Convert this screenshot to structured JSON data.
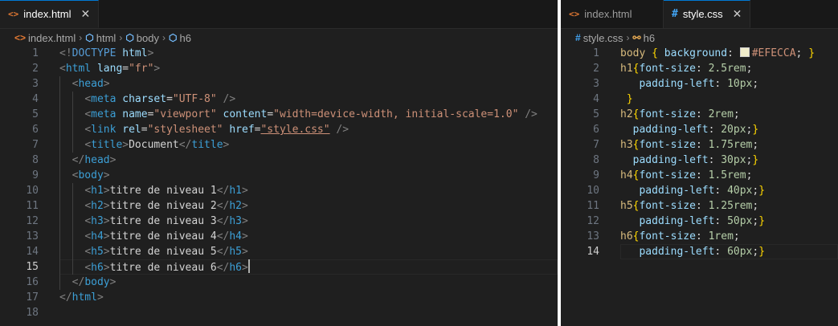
{
  "left": {
    "tab": {
      "icon": "html-file-icon",
      "label": "index.html",
      "close": "✕"
    },
    "breadcrumb": [
      "index.html",
      "html",
      "body",
      "h6"
    ],
    "current_line": 15,
    "lines": [
      [
        [
          "t-punc",
          "<!"
        ],
        [
          "t-decl",
          "DOCTYPE"
        ],
        [
          "t-text",
          " "
        ],
        [
          "t-attr",
          "html"
        ],
        [
          "t-punc",
          ">"
        ]
      ],
      [
        [
          "t-punc",
          "<"
        ],
        [
          "t-tag",
          "html"
        ],
        [
          "t-text",
          " "
        ],
        [
          "t-attr",
          "lang"
        ],
        [
          "t-text",
          "="
        ],
        [
          "t-str",
          "\"fr\""
        ],
        [
          "t-punc",
          ">"
        ]
      ],
      [
        [
          "t-text",
          "  "
        ],
        [
          "t-punc",
          "<"
        ],
        [
          "t-tag",
          "head"
        ],
        [
          "t-punc",
          ">"
        ]
      ],
      [
        [
          "t-text",
          "    "
        ],
        [
          "t-punc",
          "<"
        ],
        [
          "t-tag",
          "meta"
        ],
        [
          "t-text",
          " "
        ],
        [
          "t-attr",
          "charset"
        ],
        [
          "t-text",
          "="
        ],
        [
          "t-str",
          "\"UTF-8\""
        ],
        [
          "t-text",
          " "
        ],
        [
          "t-punc",
          "/>"
        ]
      ],
      [
        [
          "t-text",
          "    "
        ],
        [
          "t-punc",
          "<"
        ],
        [
          "t-tag",
          "meta"
        ],
        [
          "t-text",
          " "
        ],
        [
          "t-attr",
          "name"
        ],
        [
          "t-text",
          "="
        ],
        [
          "t-str",
          "\"viewport\""
        ],
        [
          "t-text",
          " "
        ],
        [
          "t-attr",
          "content"
        ],
        [
          "t-text",
          "="
        ],
        [
          "t-str",
          "\"width=device-width, initial-scale=1.0\""
        ],
        [
          "t-text",
          " "
        ],
        [
          "t-punc",
          "/>"
        ]
      ],
      [
        [
          "t-text",
          "    "
        ],
        [
          "t-punc",
          "<"
        ],
        [
          "t-tag",
          "link"
        ],
        [
          "t-text",
          " "
        ],
        [
          "t-attr",
          "rel"
        ],
        [
          "t-text",
          "="
        ],
        [
          "t-str",
          "\"stylesheet\""
        ],
        [
          "t-text",
          " "
        ],
        [
          "t-attr",
          "href"
        ],
        [
          "t-text",
          "="
        ],
        [
          "t-str u",
          "\"style.css\""
        ],
        [
          "t-text",
          " "
        ],
        [
          "t-punc",
          "/>"
        ]
      ],
      [
        [
          "t-text",
          "    "
        ],
        [
          "t-punc",
          "<"
        ],
        [
          "t-tag",
          "title"
        ],
        [
          "t-punc",
          ">"
        ],
        [
          "t-text",
          "Document"
        ],
        [
          "t-punc",
          "</"
        ],
        [
          "t-tag",
          "title"
        ],
        [
          "t-punc",
          ">"
        ]
      ],
      [
        [
          "t-text",
          "  "
        ],
        [
          "t-punc",
          "</"
        ],
        [
          "t-tag",
          "head"
        ],
        [
          "t-punc",
          ">"
        ]
      ],
      [
        [
          "t-text",
          "  "
        ],
        [
          "t-punc",
          "<"
        ],
        [
          "t-tag",
          "body"
        ],
        [
          "t-punc",
          ">"
        ]
      ],
      [
        [
          "t-text",
          "    "
        ],
        [
          "t-punc",
          "<"
        ],
        [
          "t-tag",
          "h1"
        ],
        [
          "t-punc",
          ">"
        ],
        [
          "t-text",
          "titre de niveau 1"
        ],
        [
          "t-punc",
          "</"
        ],
        [
          "t-tag",
          "h1"
        ],
        [
          "t-punc",
          ">"
        ]
      ],
      [
        [
          "t-text",
          "    "
        ],
        [
          "t-punc",
          "<"
        ],
        [
          "t-tag",
          "h2"
        ],
        [
          "t-punc",
          ">"
        ],
        [
          "t-text",
          "titre de niveau 2"
        ],
        [
          "t-punc",
          "</"
        ],
        [
          "t-tag",
          "h2"
        ],
        [
          "t-punc",
          ">"
        ]
      ],
      [
        [
          "t-text",
          "    "
        ],
        [
          "t-punc",
          "<"
        ],
        [
          "t-tag",
          "h3"
        ],
        [
          "t-punc",
          ">"
        ],
        [
          "t-text",
          "titre de niveau 3"
        ],
        [
          "t-punc",
          "</"
        ],
        [
          "t-tag",
          "h3"
        ],
        [
          "t-punc",
          ">"
        ]
      ],
      [
        [
          "t-text",
          "    "
        ],
        [
          "t-punc",
          "<"
        ],
        [
          "t-tag",
          "h4"
        ],
        [
          "t-punc",
          ">"
        ],
        [
          "t-text",
          "titre de niveau 4"
        ],
        [
          "t-punc",
          "</"
        ],
        [
          "t-tag",
          "h4"
        ],
        [
          "t-punc",
          ">"
        ]
      ],
      [
        [
          "t-text",
          "    "
        ],
        [
          "t-punc",
          "<"
        ],
        [
          "t-tag",
          "h5"
        ],
        [
          "t-punc",
          ">"
        ],
        [
          "t-text",
          "titre de niveau 5"
        ],
        [
          "t-punc",
          "</"
        ],
        [
          "t-tag",
          "h5"
        ],
        [
          "t-punc",
          ">"
        ]
      ],
      [
        [
          "t-text",
          "    "
        ],
        [
          "t-punc",
          "<"
        ],
        [
          "t-tag",
          "h6"
        ],
        [
          "t-punc",
          ">"
        ],
        [
          "t-text",
          "titre de niveau 6"
        ],
        [
          "t-punc",
          "</"
        ],
        [
          "t-tag",
          "h6"
        ],
        [
          "t-punc",
          ">"
        ],
        [
          "caret",
          ""
        ]
      ],
      [
        [
          "t-text",
          "  "
        ],
        [
          "t-punc",
          "</"
        ],
        [
          "t-tag",
          "body"
        ],
        [
          "t-punc",
          ">"
        ]
      ],
      [
        [
          "t-punc",
          "</"
        ],
        [
          "t-tag",
          "html"
        ],
        [
          "t-punc",
          ">"
        ]
      ],
      []
    ]
  },
  "right": {
    "tabs": [
      {
        "icon": "html-file-icon",
        "label": "index.html",
        "active": false
      },
      {
        "icon": "css-file-icon",
        "label": "style.css",
        "active": true,
        "close": "✕"
      }
    ],
    "breadcrumb": [
      "style.css",
      "h6"
    ],
    "current_line": 14,
    "lines": [
      [
        [
          "t-sel",
          "body"
        ],
        [
          "t-text",
          " "
        ],
        [
          "t-brace",
          "{"
        ],
        [
          "t-text",
          " "
        ],
        [
          "t-prop",
          "background"
        ],
        [
          "t-text",
          ": "
        ],
        [
          "swatch",
          ""
        ],
        [
          "t-str",
          "#EFECCA"
        ],
        [
          "t-text",
          "; "
        ],
        [
          "t-brace",
          "}"
        ]
      ],
      [
        [
          "t-sel",
          "h1"
        ],
        [
          "t-brace",
          "{"
        ],
        [
          "t-prop",
          "font-size"
        ],
        [
          "t-text",
          ": "
        ],
        [
          "t-num",
          "2.5rem"
        ],
        [
          "t-text",
          ";"
        ]
      ],
      [
        [
          "t-text",
          "   "
        ],
        [
          "t-prop",
          "padding-left"
        ],
        [
          "t-text",
          ": "
        ],
        [
          "t-num",
          "10px"
        ],
        [
          "t-text",
          ";"
        ]
      ],
      [
        [
          "t-text",
          " "
        ],
        [
          "t-brace",
          "}"
        ]
      ],
      [
        [
          "t-sel",
          "h2"
        ],
        [
          "t-brace",
          "{"
        ],
        [
          "t-prop",
          "font-size"
        ],
        [
          "t-text",
          ": "
        ],
        [
          "t-num",
          "2rem"
        ],
        [
          "t-text",
          ";"
        ]
      ],
      [
        [
          "t-text",
          "  "
        ],
        [
          "t-prop",
          "padding-left"
        ],
        [
          "t-text",
          ": "
        ],
        [
          "t-num",
          "20px"
        ],
        [
          "t-text",
          ";"
        ],
        [
          "t-brace",
          "}"
        ]
      ],
      [
        [
          "t-sel",
          "h3"
        ],
        [
          "t-brace",
          "{"
        ],
        [
          "t-prop",
          "font-size"
        ],
        [
          "t-text",
          ": "
        ],
        [
          "t-num",
          "1.75rem"
        ],
        [
          "t-text",
          ";"
        ]
      ],
      [
        [
          "t-text",
          "  "
        ],
        [
          "t-prop",
          "padding-left"
        ],
        [
          "t-text",
          ": "
        ],
        [
          "t-num",
          "30px"
        ],
        [
          "t-text",
          ";"
        ],
        [
          "t-brace",
          "}"
        ]
      ],
      [
        [
          "t-sel",
          "h4"
        ],
        [
          "t-brace",
          "{"
        ],
        [
          "t-prop",
          "font-size"
        ],
        [
          "t-text",
          ": "
        ],
        [
          "t-num",
          "1.5rem"
        ],
        [
          "t-text",
          ";"
        ]
      ],
      [
        [
          "t-text",
          "   "
        ],
        [
          "t-prop",
          "padding-left"
        ],
        [
          "t-text",
          ": "
        ],
        [
          "t-num",
          "40px"
        ],
        [
          "t-text",
          ";"
        ],
        [
          "t-brace",
          "}"
        ]
      ],
      [
        [
          "t-sel",
          "h5"
        ],
        [
          "t-brace",
          "{"
        ],
        [
          "t-prop",
          "font-size"
        ],
        [
          "t-text",
          ": "
        ],
        [
          "t-num",
          "1.25rem"
        ],
        [
          "t-text",
          ";"
        ]
      ],
      [
        [
          "t-text",
          "   "
        ],
        [
          "t-prop",
          "padding-left"
        ],
        [
          "t-text",
          ": "
        ],
        [
          "t-num",
          "50px"
        ],
        [
          "t-text",
          ";"
        ],
        [
          "t-brace",
          "}"
        ]
      ],
      [
        [
          "t-sel",
          "h6"
        ],
        [
          "t-brace",
          "{"
        ],
        [
          "t-prop",
          "font-size"
        ],
        [
          "t-text",
          ": "
        ],
        [
          "t-num",
          "1rem"
        ],
        [
          "t-text",
          ";"
        ]
      ],
      [
        [
          "t-text",
          "   "
        ],
        [
          "t-prop",
          "padding-left"
        ],
        [
          "t-text",
          ": "
        ],
        [
          "t-num",
          "60px"
        ],
        [
          "t-text",
          ";"
        ],
        [
          "t-brace",
          "}"
        ]
      ]
    ]
  },
  "colors": {
    "accent": "#0078d4",
    "html_icon": "#e37933",
    "css_icon": "#42a5f5",
    "swatch": "#EFECCA"
  }
}
